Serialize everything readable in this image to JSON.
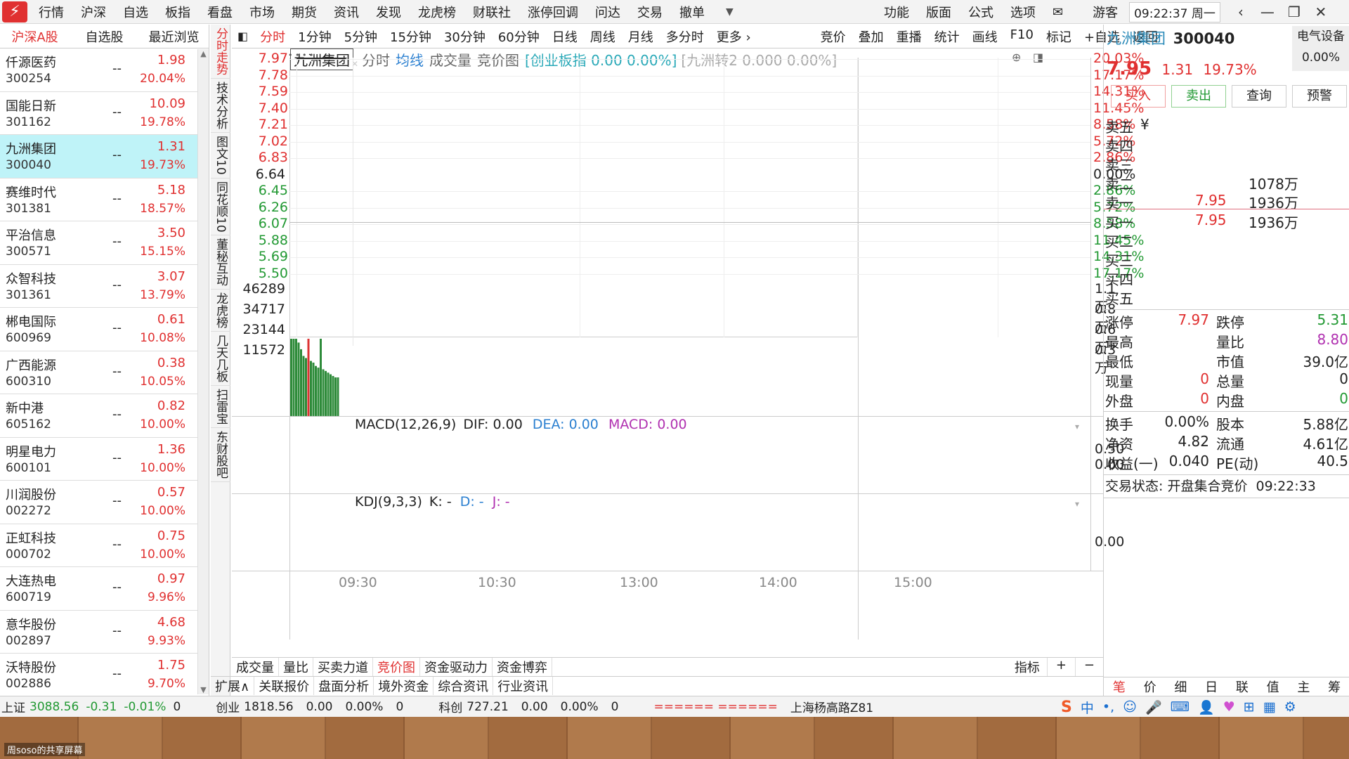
{
  "menu": {
    "items": [
      "行情",
      "沪深",
      "自选",
      "板指",
      "看盘",
      "市场",
      "期货",
      "资讯",
      "发现",
      "龙虎榜",
      "财联社",
      "涨停回调",
      "问达",
      "交易",
      "撤单"
    ],
    "right_items": [
      "功能",
      "版面",
      "公式",
      "选项"
    ],
    "user": "游客",
    "clock": "09:22:37 周一"
  },
  "left_tabs": [
    "沪深A股",
    "自选股",
    "最近浏览"
  ],
  "stocks": [
    {
      "name": "仟源医药",
      "code": "300254",
      "change": "1.98",
      "pct": "20.04%"
    },
    {
      "name": "国能日新",
      "code": "301162",
      "change": "10.09",
      "pct": "19.78%"
    },
    {
      "name": "九洲集团",
      "code": "300040",
      "change": "1.31",
      "pct": "19.73%"
    },
    {
      "name": "赛维时代",
      "code": "301381",
      "change": "5.18",
      "pct": "18.57%"
    },
    {
      "name": "平治信息",
      "code": "300571",
      "change": "3.50",
      "pct": "15.15%"
    },
    {
      "name": "众智科技",
      "code": "301361",
      "change": "3.07",
      "pct": "13.79%"
    },
    {
      "name": "郴电国际",
      "code": "600969",
      "change": "0.61",
      "pct": "10.08%"
    },
    {
      "name": "广西能源",
      "code": "600310",
      "change": "0.38",
      "pct": "10.05%"
    },
    {
      "name": "新中港",
      "code": "605162",
      "change": "0.82",
      "pct": "10.00%"
    },
    {
      "name": "明星电力",
      "code": "600101",
      "change": "1.36",
      "pct": "10.00%"
    },
    {
      "name": "川润股份",
      "code": "002272",
      "change": "0.57",
      "pct": "10.00%"
    },
    {
      "name": "正虹科技",
      "code": "000702",
      "change": "0.75",
      "pct": "10.00%"
    },
    {
      "name": "大连热电",
      "code": "600719",
      "change": "0.97",
      "pct": "9.96%"
    },
    {
      "name": "意华股份",
      "code": "002897",
      "change": "4.68",
      "pct": "9.93%"
    },
    {
      "name": "沃特股份",
      "code": "002886",
      "change": "1.75",
      "pct": "9.70%"
    }
  ],
  "stock_dash": "--",
  "vtabs": [
    "分时走势",
    "技术分析",
    "图文10",
    "同花顺10",
    "董秘互动",
    "龙虎榜",
    "几天几板",
    "扫雷宝",
    "东财股吧"
  ],
  "chart_toolbar": [
    "分时",
    "1分钟",
    "5分钟",
    "15分钟",
    "30分钟",
    "60分钟",
    "日线",
    "周线",
    "月线",
    "多分时",
    "更多 ›",
    "竞价",
    "叠加",
    "重播",
    "统计",
    "画线",
    "F10",
    "标记",
    "+自选",
    "返回"
  ],
  "chart_header": {
    "stock": "九洲集团",
    "tabs": [
      "分时",
      "均线",
      "成交量",
      "竞价图"
    ],
    "index_info": "[创业板指 0.00 0.00%]",
    "bond_info": "[九洲转2 0.000 0.00%]"
  },
  "price_axis": {
    "left": [
      "7.97",
      "7.78",
      "7.59",
      "7.40",
      "7.21",
      "7.02",
      "6.83",
      "6.64",
      "6.45",
      "6.26",
      "6.07",
      "5.88",
      "5.69",
      "5.50"
    ],
    "right": [
      "20.03%",
      "17.17%",
      "14.31%",
      "11.45%",
      "8.58%",
      "5.72%",
      "2.86%",
      "0.00%",
      "2.86%",
      "5.72%",
      "8.58%",
      "11.45%",
      "14.31%",
      "17.17%"
    ]
  },
  "volume_axis": {
    "left": [
      "46289",
      "34717",
      "23144",
      "11572"
    ],
    "right": [
      "1.1万",
      "0.8万",
      "0.6万",
      "0.3万"
    ]
  },
  "macd": {
    "label": "MACD(12,26,9)",
    "dif": "DIF: 0.00",
    "dea": "DEA: 0.00",
    "macd": "MACD: 0.00",
    "axis": [
      "0.50",
      "0.00"
    ]
  },
  "kdj": {
    "label": "KDJ(9,3,3)",
    "k": "K: -",
    "d": "D: -",
    "j": "J: -",
    "axis": [
      "0.00"
    ]
  },
  "time_axis": [
    "09:30",
    "10:30",
    "13:00",
    "14:00",
    "15:00"
  ],
  "auction_volumes": [
    {
      "value": 46289,
      "color": "green"
    },
    {
      "value": 46289,
      "color": "green"
    },
    {
      "value": 46289,
      "color": "green"
    },
    {
      "value": 44000,
      "color": "green"
    },
    {
      "value": 40000,
      "color": "green"
    },
    {
      "value": 36000,
      "color": "green"
    },
    {
      "value": 34717,
      "color": "green"
    },
    {
      "value": 46289,
      "color": "red"
    },
    {
      "value": 33000,
      "color": "green"
    },
    {
      "value": 32000,
      "color": "green"
    },
    {
      "value": 30000,
      "color": "green"
    },
    {
      "value": 29000,
      "color": "green"
    },
    {
      "value": 46289,
      "color": "green"
    },
    {
      "value": 28000,
      "color": "green"
    },
    {
      "value": 27000,
      "color": "green"
    },
    {
      "value": 26000,
      "color": "green"
    },
    {
      "value": 25000,
      "color": "green"
    },
    {
      "value": 24000,
      "color": "green"
    },
    {
      "value": 23144,
      "color": "green"
    },
    {
      "value": 23144,
      "color": "green"
    }
  ],
  "bottom_tabs1": [
    "成交量",
    "量比",
    "买卖力道",
    "竞价图",
    "资金驱动力",
    "资金博弈"
  ],
  "bottom_tabs1_right": [
    "指标",
    "+",
    "−"
  ],
  "bottom_tabs2": [
    "扩展∧",
    "关联报价",
    "盘面分析",
    "境外资金",
    "综合资讯",
    "行业资讯"
  ],
  "right": {
    "name": "九洲集团",
    "code": "300040",
    "sector": "电气设备",
    "price": "7.95",
    "change": "1.31",
    "pct": "19.73%",
    "sector_pct": "0.00%",
    "buttons": [
      "买入",
      "卖出",
      "查询",
      "预警"
    ],
    "sell_labels": [
      "卖五",
      "卖四",
      "卖三",
      "卖二",
      "卖一"
    ],
    "sell5_sym": "¥",
    "sell2_vol": "1078万",
    "sell1_price": "7.95",
    "sell1_vol": "1936万",
    "buy_labels": [
      "买一",
      "买二",
      "买三",
      "买四",
      "买五"
    ],
    "buy1_price": "7.95",
    "buy1_vol": "1936万",
    "stats": [
      {
        "l": "涨停",
        "v": "7.97",
        "vc": "red",
        "l2": "跌停",
        "v2": "5.31",
        "v2c": "green"
      },
      {
        "l": "最高",
        "v": "",
        "vc": "",
        "l2": "量比",
        "v2": "8.80",
        "v2c": "purple"
      },
      {
        "l": "最低",
        "v": "",
        "vc": "",
        "l2": "市值",
        "v2": "39.0亿",
        "v2c": ""
      },
      {
        "l": "现量",
        "v": "0",
        "vc": "red",
        "l2": "总量",
        "v2": "0",
        "v2c": ""
      },
      {
        "l": "外盘",
        "v": "0",
        "vc": "red",
        "l2": "内盘",
        "v2": "0",
        "v2c": "green"
      }
    ],
    "stats2": [
      {
        "l": "换手",
        "v": "0.00%",
        "l2": "股本",
        "v2": "5.88亿"
      },
      {
        "l": "净资",
        "v": "4.82",
        "l2": "流通",
        "v2": "4.61亿"
      },
      {
        "l": "收益(一)",
        "v": "0.040",
        "l2": "PE(动)",
        "v2": "40.5"
      }
    ],
    "trade_status": "交易状态: 开盘集合竞价",
    "trade_time": "09:22:33",
    "bottom_tabs": [
      "笔",
      "价",
      "细",
      "日",
      "联",
      "值",
      "主",
      "筹"
    ]
  },
  "status": {
    "sh_label": "上证",
    "sh_val": "3088.56",
    "sh_chg": "-0.31",
    "sh_pct": "-0.01%",
    "sh_vol": "0",
    "cy_label": "创业",
    "cy_val": "1818.56",
    "cy_chg": "0.00",
    "cy_pct": "0.00%",
    "cy_vol": "0",
    "kc_label": "科创",
    "kc_val": "727.21",
    "kc_chg": "0.00",
    "kc_pct": "0.00%",
    "kc_vol": "0",
    "ticker": "====== ======",
    "location": "上海杨高路Z81"
  },
  "footer_caption": "周soso的共享屏幕"
}
